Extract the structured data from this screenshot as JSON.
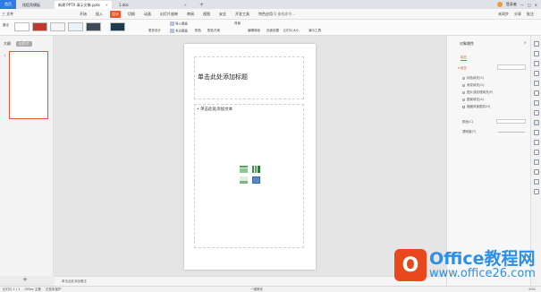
{
  "tabs": [
    {
      "label": "首页"
    },
    {
      "label": "找稻壳模板"
    },
    {
      "label": "新建 PPTX 演示文稿.pptx"
    },
    {
      "label": "1.doc"
    }
  ],
  "tabbar_right": {
    "user": "登录者"
  },
  "menu": {
    "file": "三 文件",
    "items": [
      "开始",
      "插入",
      "设计",
      "切换",
      "动画",
      "幻灯片放映",
      "审阅",
      "视图",
      "安全",
      "开发工具",
      "特色应用"
    ],
    "active": "设计",
    "search": "Q 查找命令...",
    "right": [
      "未同步",
      "分享",
      "批注"
    ]
  },
  "toolbar": {
    "more_label": "魔法",
    "items": [
      "更多设计",
      "导入模板",
      "本文模板",
      "配色",
      "背景",
      "配色方案",
      "编辑母版",
      "页面设置",
      "幻灯片大小",
      "演示工具"
    ]
  },
  "left_panel": {
    "outline": "大纲",
    "slides": "幻灯片",
    "slide_number": "1"
  },
  "slide": {
    "title_placeholder": "单击此处添加标题",
    "body_placeholder": "• 单击此处添加文本"
  },
  "notes": "单击此处添加备注",
  "right_panel": {
    "title": "对象属性",
    "tab": "填充",
    "section": "▾ 填充",
    "options": [
      "纯色填充(S)",
      "渐变填充(G)",
      "图片或纹理填充(P)",
      "图案填充(A)",
      "隐藏背景图形(H)"
    ],
    "color_label": "颜色(C)",
    "transparency_label": "透明度(T)"
  },
  "status": {
    "slide_count": "幻灯片 1 / 1",
    "theme": "Office 主题",
    "autocorrect": "文档未保护",
    "note": "一键美化",
    "zoom": "40%"
  },
  "watermark": {
    "logo": "O",
    "title": "Office教程网",
    "url": "www.office26.com"
  },
  "colors": {
    "accent": "#e8542c",
    "home_tab": "#2f7be6",
    "watermark": "#2d8fe6"
  }
}
